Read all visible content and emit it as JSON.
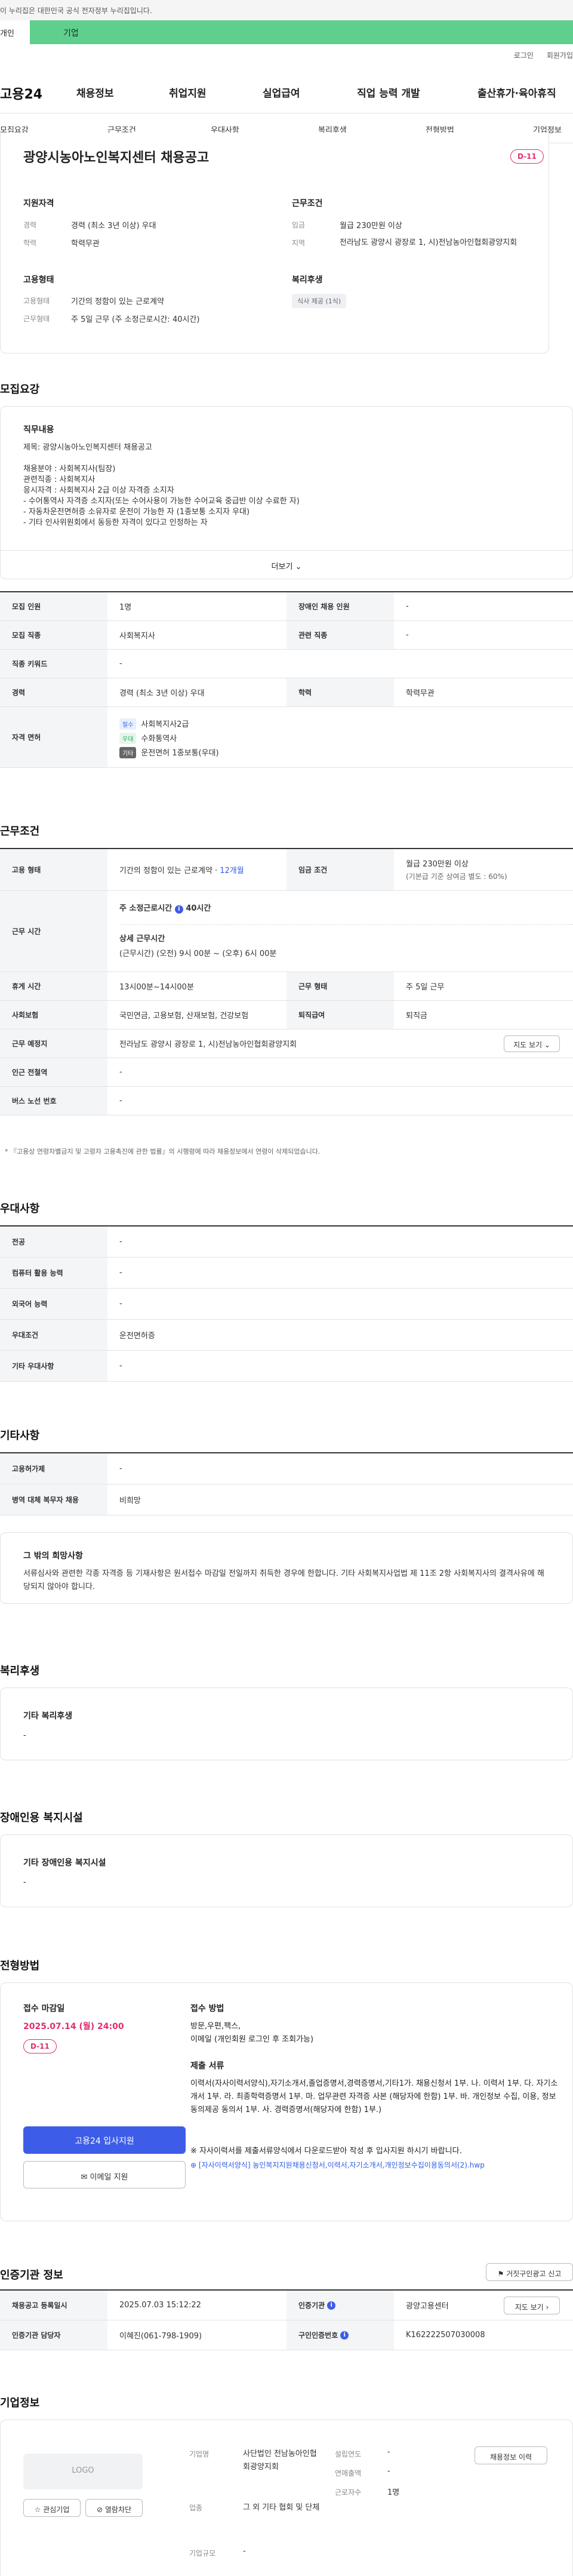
{
  "topbar": {
    "gov_text": "이 누리집은 대한민국 공식 전자정부 누리집입니다.",
    "tab_individual": "개인",
    "tab_business": "기업"
  },
  "util": {
    "login": "로그인",
    "join": "회원가입"
  },
  "gnb": {
    "logo": "고용24",
    "items": [
      "채용정보",
      "취업지원",
      "실업급여",
      "직업 능력 개발",
      "출산휴가·육아휴직"
    ]
  },
  "snb": {
    "items": [
      "모집요강",
      "근무조건",
      "우대사항",
      "복리후생",
      "전형방법",
      "기업정보"
    ]
  },
  "header": {
    "title": "광양시농아노인복지센터 채용공고",
    "dday": "D-11",
    "left_title": "지원자격",
    "career_label": "경력",
    "career_value": "경력 (최소 3년 이상) 우대",
    "edu_label": "학력",
    "edu_value": "학력무관",
    "right_title": "근무조건",
    "wage_label": "임금",
    "wage_value": "월급 230만원 이상",
    "region_label": "지역",
    "region_value": "전라남도 광양시 광장로 1, 시)전남농아인협회광양지회",
    "emp_title": "고용형태",
    "emptype_label": "고용형태",
    "emptype_value": "기간의 정함이 있는 근로계약",
    "worktime_label": "근무형태",
    "worktime_value": "주 5일 근무 (주 소정근로시간: 40시간)",
    "welfare_title": "복리후생",
    "welfare_tag": "식사 제공 (1식)"
  },
  "recruit": {
    "section_title": "모집요강",
    "desc_title": "직무내용",
    "desc_lines": [
      "제목: 광양시농아노인복지센터 채용공고",
      "",
      "채용분야 : 사회복지사(팀장)",
      "관련직종 : 사회복지사",
      "응시자격 : 사회복지사 2급 이상 자격증 소지자",
      "- 수어통역사 자격증 소지자(또는 수어사용이 가능한 수어교육 중급반 이상 수료한 자)",
      "- 자동차운전면허증 소유자로 운전이 가능한 자 (1종보통 소지자 우대)",
      "- 기타 인사위원회에서 동등한 자격이 있다고 인정하는 자"
    ],
    "more": "더보기",
    "rows": [
      {
        "k1": "모집 인원",
        "v1": "1명",
        "k2": "장애인 채용 인원",
        "v2": "-"
      },
      {
        "k1": "모집 직종",
        "v1": "사회복지사",
        "k2": "관련 직종",
        "v2": "-"
      },
      {
        "k1": "직종 키워드",
        "v1": "-"
      },
      {
        "k1": "경력",
        "v1": "경력 (최소 3년 이상) 우대",
        "k2": "학력",
        "v2": "학력무관"
      }
    ],
    "license_label": "자격 면허",
    "licenses": [
      {
        "badge": "필수",
        "name": "사회복지사2급"
      },
      {
        "badge": "우대",
        "name": "수화통역사"
      },
      {
        "badge": "기타",
        "name": "운전면허 1종보통(우대)"
      }
    ]
  },
  "conditions": {
    "section_title": "근무조건",
    "emp_label": "고용 형태",
    "emp_value": "기간의 정함이 있는 근로계약 · ",
    "emp_period": "12개월",
    "wage_label": "임금 조건",
    "wage_value": "월급 230만원 이상",
    "wage_sub": "(기본급 기준 상여금 별도 : 60%)",
    "time_label": "근무 시간",
    "time_week": "주 소정근로시간",
    "time_hours": "40시간",
    "time_detail_title": "상세 근무시간",
    "time_detail": "(근무시간) (오전) 9시 00분 ~ (오후) 6시 00분",
    "rest_label": "휴게 시간",
    "rest_value": "13시00분~14시00분",
    "form_label": "근무 형태",
    "form_value": "주 5일 근무",
    "ins_label": "사회보험",
    "ins_value": "국민연금, 고용보험, 산재보험, 건강보험",
    "ret_label": "퇴직급여",
    "ret_value": "퇴직금",
    "place_label": "근무 예정지",
    "place_value": "전라남도 광양시 광장로 1, 시)전남농아인협회광양지회",
    "map_btn": "지도 보기",
    "subway_label": "인근 전철역",
    "subway_value": "-",
    "bus_label": "버스 노선 번호",
    "bus_value": "-",
    "note": "* 『고용상 연령차별금지 및 고령자 고용촉진에 관한 법률』의 시행령에 따라 채용정보에서 연령이 삭제되었습니다."
  },
  "preference": {
    "section_title": "우대사항",
    "rows": [
      {
        "k": "전공",
        "v": "-"
      },
      {
        "k": "컴퓨터 활용 능력",
        "v": "-"
      },
      {
        "k": "외국어 능력",
        "v": "-"
      },
      {
        "k": "우대조건",
        "v": "운전면허증"
      },
      {
        "k": "기타 우대사항",
        "v": "-"
      }
    ]
  },
  "etc": {
    "section_title": "기타사항",
    "rows": [
      {
        "k": "고용허가제",
        "v": "-"
      },
      {
        "k": "병역 대체 복무자 채용",
        "v": "비희망"
      }
    ],
    "other_title": "그 밖의 희망사항",
    "other_text": "서류심사와 관련한 각종 자격증 등 기재사항은 원서접수 마감일 전일까지 취득한 경우에 한합니다. 기타 사회복지사업법 제 11조 2항 사회복지사의 결격사유에 해당되지 않아야 합니다."
  },
  "welfare": {
    "section_title": "복리후생",
    "box_title": "기타 복리후생",
    "box_value": "-"
  },
  "disabled": {
    "section_title": "장애인용 복지시설",
    "box_title": "기타 장애인용 복지시설",
    "box_value": "-"
  },
  "process": {
    "section_title": "전형방법",
    "deadline_title": "접수 마감일",
    "deadline": "2025.07.14 (월) 24:00",
    "dday": "D-11",
    "apply_btn": "고용24 입사지원",
    "mail_btn": "이메일 지원",
    "method_title": "접수 방법",
    "method_text": "방문,우편,팩스,\n이메일 (개인회원 로그인 후 조회가능)",
    "docs_title": "제출 서류",
    "docs_text": "이력서(자사이력서양식),자기소개서,졸업증명서,경력증명서,기타1가. 채용신청서 1부. 나. 이력서 1부. 다. 자기소개서 1부. 라. 최종학력증명서 1부. 마. 업무관련 자격증 사본 (해당자에 한함) 1부. 바. 개인정보 수집, 이용, 정보동의제공 동의서 1부. 사. 경력증명서(해당자에 한함) 1부.)",
    "docs_note": "※ 자사이력서를 제출서류양식에서 다운로드받아 작성 후 입사지원 하시기 바랍니다.",
    "file": "[자사이력서양식] 농인복지지원채용신청서,이력서,자기소개서,개인정보수집이용동의서(2).hwp"
  },
  "certified": {
    "section_title": "인증기관 정보",
    "report_btn": "거짓구인광고 신고",
    "date_label": "채용공고 등록일시",
    "date_value": "2025.07.03 15:12:22",
    "org_label": "인증기관",
    "org_value": "광양고용센터",
    "map_btn": "지도 보기",
    "manager_label": "인증기관 담당자",
    "manager_value": "이혜진(061-798-1909)",
    "no_label": "구인인증번호",
    "no_value": "K162222507030008"
  },
  "company": {
    "section_title": "기업정보",
    "logo": "LOGO",
    "fav_btn": "관심기업",
    "block_btn": "열람차단",
    "list_btn": "채용정보 이력",
    "name_label": "기업명",
    "name_value": "사단법인 전남농아인협회광양지회",
    "industry_label": "업종",
    "industry_value": "그 외 기타 협회 및 단체",
    "size_label": "기업규모",
    "size_value": "-",
    "founded_label": "설립연도",
    "founded_value": "-",
    "sales_label": "연매출액",
    "sales_value": "-",
    "emp_label": "근로자수",
    "emp_value": "1명"
  },
  "colors": {
    "accent_green": "#5ecf8c",
    "brand_pink": "#e02e71",
    "primary_blue": "#3d5de8"
  }
}
